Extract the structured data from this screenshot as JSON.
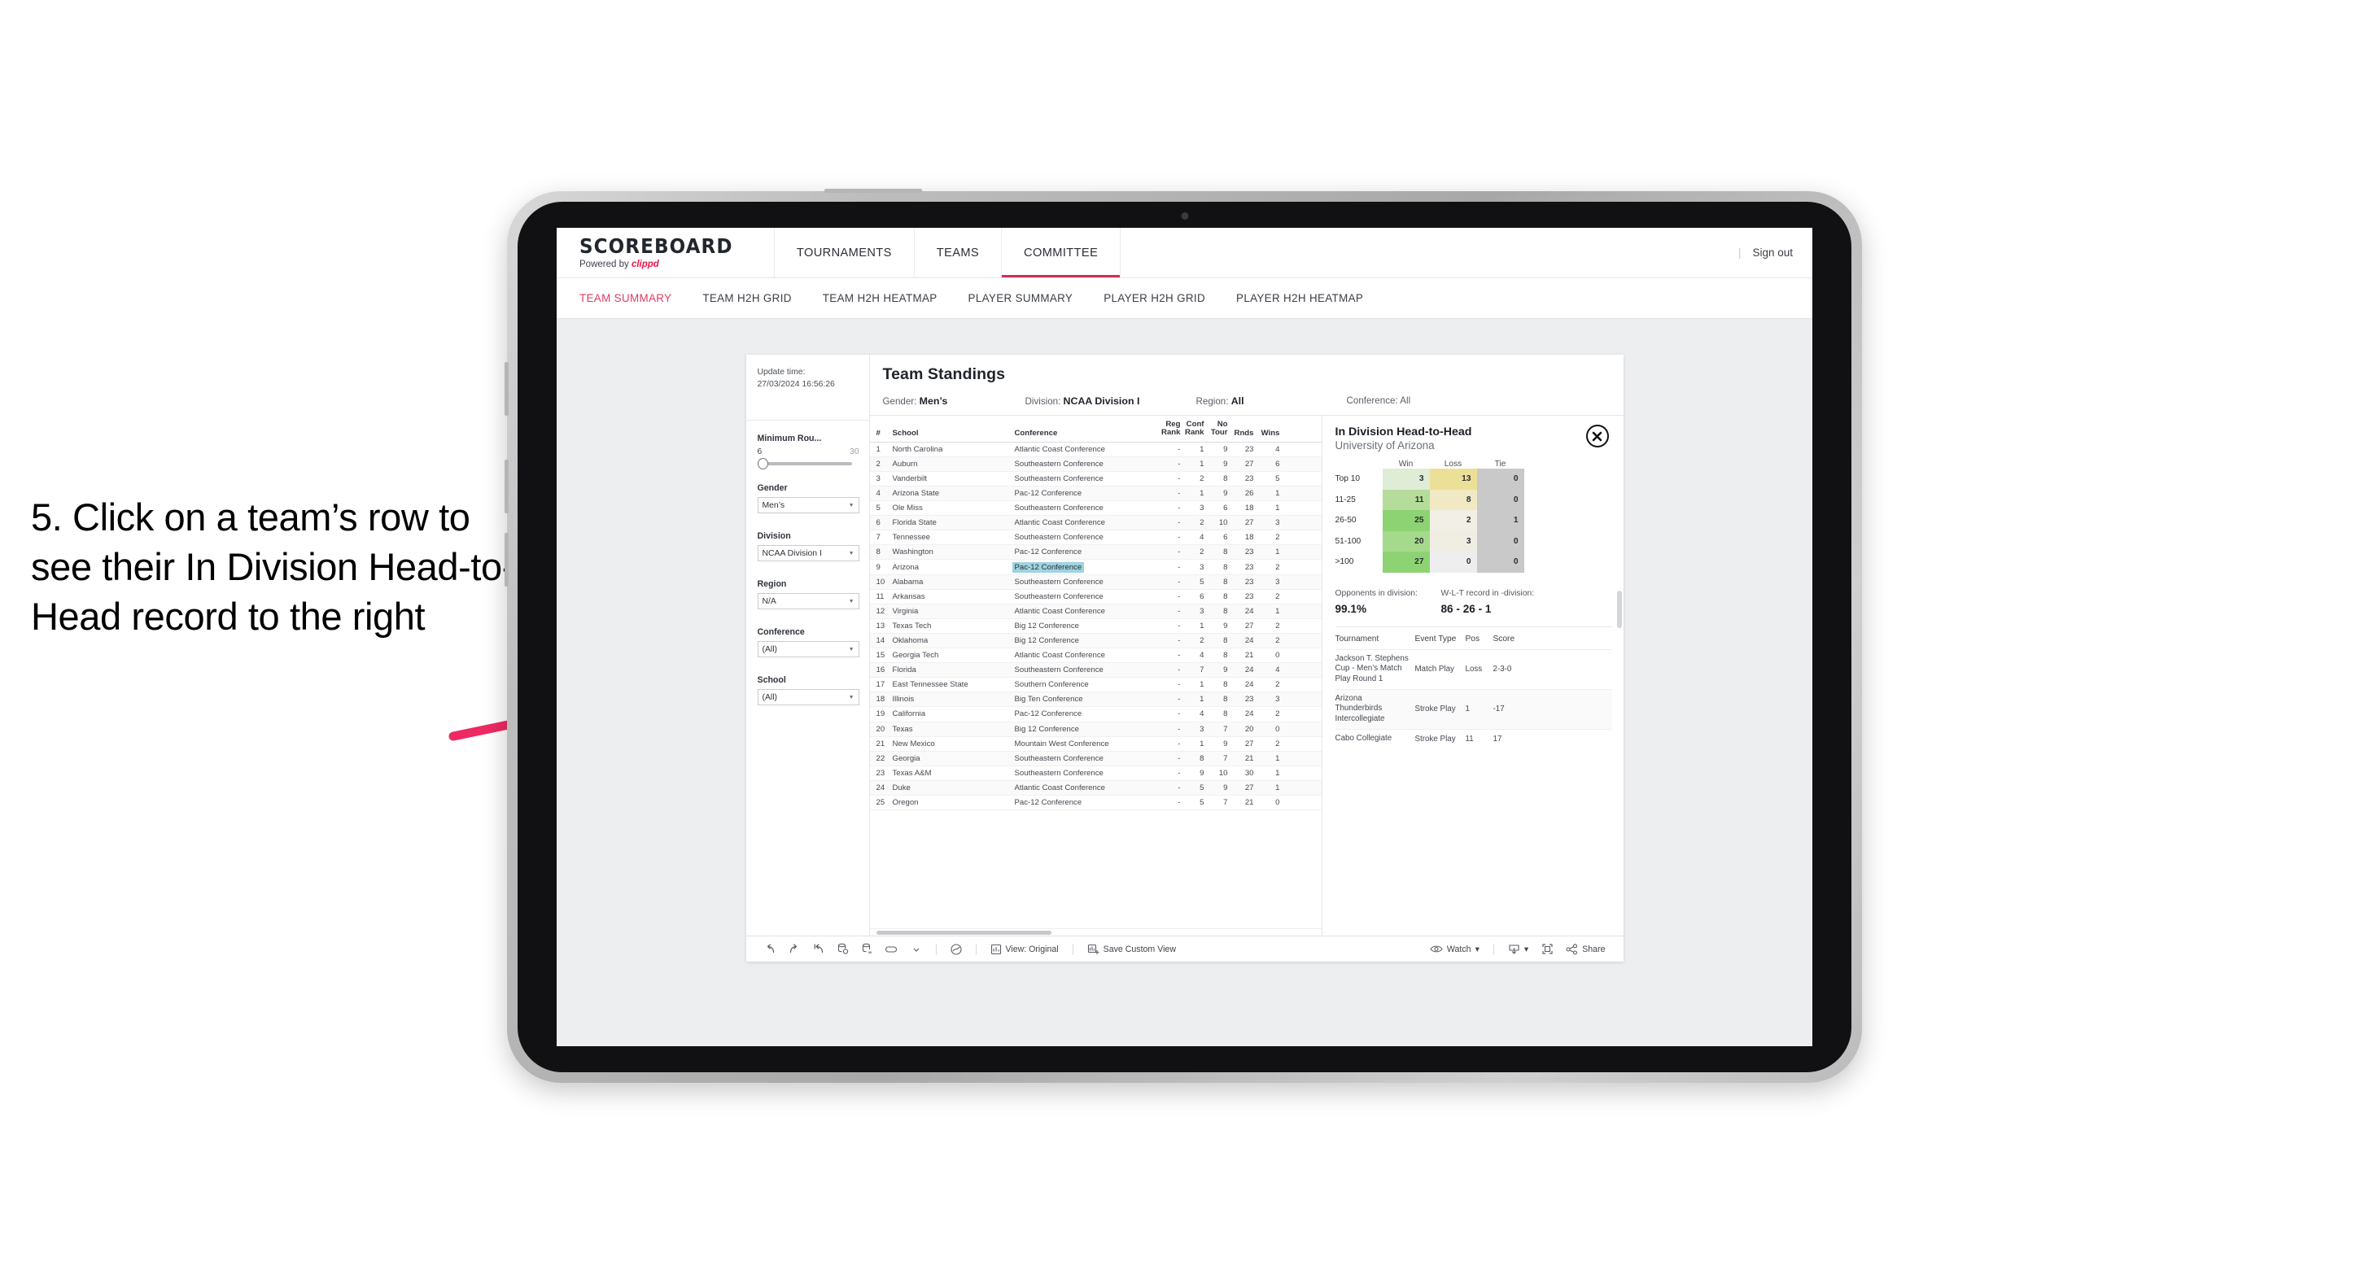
{
  "annotation": {
    "text": "5. Click on a team’s row to see their In Division Head-to-Head record to the right",
    "arrow_color": "#ed2a63"
  },
  "header": {
    "brand_title": "SCOREBOARD",
    "brand_sub_prefix": "Powered by ",
    "brand_sub_name": "clippd",
    "nav": [
      {
        "label": "TOURNAMENTS",
        "active": false
      },
      {
        "label": "TEAMS",
        "active": false
      },
      {
        "label": "COMMITTEE",
        "active": true
      }
    ],
    "divider": "|",
    "sign_out": "Sign out"
  },
  "subnav": {
    "items": [
      {
        "label": "TEAM SUMMARY",
        "active": true
      },
      {
        "label": "TEAM H2H GRID",
        "active": false
      },
      {
        "label": "TEAM H2H HEATMAP",
        "active": false
      },
      {
        "label": "PLAYER SUMMARY",
        "active": false
      },
      {
        "label": "PLAYER H2H GRID",
        "active": false
      },
      {
        "label": "PLAYER H2H HEATMAP",
        "active": false
      }
    ]
  },
  "filters": {
    "update_time_label": "Update time:",
    "update_time_value": "27/03/2024 16:56:26",
    "min_rounds": {
      "title": "Minimum Rou...",
      "min": "6",
      "max": "30"
    },
    "groups": [
      {
        "title": "Gender",
        "value": "Men’s"
      },
      {
        "title": "Division",
        "value": "NCAA Division I"
      },
      {
        "title": "Region",
        "value": "N/A"
      },
      {
        "title": "Conference",
        "value": "(All)"
      },
      {
        "title": "School",
        "value": "(All)"
      }
    ]
  },
  "standings": {
    "title": "Team Standings",
    "summary": [
      {
        "label": "Gender:",
        "value": "Men’s"
      },
      {
        "label": "Division:",
        "value": "NCAA Division I"
      },
      {
        "label": "Region:",
        "value": "All"
      },
      {
        "label": "Conference:",
        "value": "All"
      }
    ],
    "columns": {
      "num": "#",
      "school": "School",
      "conference": "Conference",
      "reg_rank_l1": "Reg",
      "reg_rank_l2": "Rank",
      "conf_rank_l1": "Conf",
      "conf_rank_l2": "Rank",
      "no_tour_l1": "No",
      "no_tour_l2": "Tour",
      "rnds": "Rnds",
      "wins": "Wins"
    },
    "rows": [
      {
        "num": "1",
        "school": "North Carolina",
        "conf": "Atlantic Coast Conference",
        "reg": "-",
        "confrank": "1",
        "notour": "9",
        "rnds": "23",
        "wins": "4",
        "selected": false
      },
      {
        "num": "2",
        "school": "Auburn",
        "conf": "Southeastern Conference",
        "reg": "-",
        "confrank": "1",
        "notour": "9",
        "rnds": "27",
        "wins": "6",
        "selected": false
      },
      {
        "num": "3",
        "school": "Vanderbilt",
        "conf": "Southeastern Conference",
        "reg": "-",
        "confrank": "2",
        "notour": "8",
        "rnds": "23",
        "wins": "5",
        "selected": false
      },
      {
        "num": "4",
        "school": "Arizona State",
        "conf": "Pac-12 Conference",
        "reg": "-",
        "confrank": "1",
        "notour": "9",
        "rnds": "26",
        "wins": "1",
        "selected": false
      },
      {
        "num": "5",
        "school": "Ole Miss",
        "conf": "Southeastern Conference",
        "reg": "-",
        "confrank": "3",
        "notour": "6",
        "rnds": "18",
        "wins": "1",
        "selected": false
      },
      {
        "num": "6",
        "school": "Florida State",
        "conf": "Atlantic Coast Conference",
        "reg": "-",
        "confrank": "2",
        "notour": "10",
        "rnds": "27",
        "wins": "3",
        "selected": false
      },
      {
        "num": "7",
        "school": "Tennessee",
        "conf": "Southeastern Conference",
        "reg": "-",
        "confrank": "4",
        "notour": "6",
        "rnds": "18",
        "wins": "2",
        "selected": false
      },
      {
        "num": "8",
        "school": "Washington",
        "conf": "Pac-12 Conference",
        "reg": "-",
        "confrank": "2",
        "notour": "8",
        "rnds": "23",
        "wins": "1",
        "selected": false
      },
      {
        "num": "9",
        "school": "Arizona",
        "conf": "Pac-12 Conference",
        "reg": "-",
        "confrank": "3",
        "notour": "8",
        "rnds": "23",
        "wins": "2",
        "selected": true
      },
      {
        "num": "10",
        "school": "Alabama",
        "conf": "Southeastern Conference",
        "reg": "-",
        "confrank": "5",
        "notour": "8",
        "rnds": "23",
        "wins": "3",
        "selected": false
      },
      {
        "num": "11",
        "school": "Arkansas",
        "conf": "Southeastern Conference",
        "reg": "-",
        "confrank": "6",
        "notour": "8",
        "rnds": "23",
        "wins": "2",
        "selected": false
      },
      {
        "num": "12",
        "school": "Virginia",
        "conf": "Atlantic Coast Conference",
        "reg": "-",
        "confrank": "3",
        "notour": "8",
        "rnds": "24",
        "wins": "1",
        "selected": false
      },
      {
        "num": "13",
        "school": "Texas Tech",
        "conf": "Big 12 Conference",
        "reg": "-",
        "confrank": "1",
        "notour": "9",
        "rnds": "27",
        "wins": "2",
        "selected": false
      },
      {
        "num": "14",
        "school": "Oklahoma",
        "conf": "Big 12 Conference",
        "reg": "-",
        "confrank": "2",
        "notour": "8",
        "rnds": "24",
        "wins": "2",
        "selected": false
      },
      {
        "num": "15",
        "school": "Georgia Tech",
        "conf": "Atlantic Coast Conference",
        "reg": "-",
        "confrank": "4",
        "notour": "8",
        "rnds": "21",
        "wins": "0",
        "selected": false
      },
      {
        "num": "16",
        "school": "Florida",
        "conf": "Southeastern Conference",
        "reg": "-",
        "confrank": "7",
        "notour": "9",
        "rnds": "24",
        "wins": "4",
        "selected": false
      },
      {
        "num": "17",
        "school": "East Tennessee State",
        "conf": "Southern Conference",
        "reg": "-",
        "confrank": "1",
        "notour": "8",
        "rnds": "24",
        "wins": "2",
        "selected": false
      },
      {
        "num": "18",
        "school": "Illinois",
        "conf": "Big Ten Conference",
        "reg": "-",
        "confrank": "1",
        "notour": "8",
        "rnds": "23",
        "wins": "3",
        "selected": false
      },
      {
        "num": "19",
        "school": "California",
        "conf": "Pac-12 Conference",
        "reg": "-",
        "confrank": "4",
        "notour": "8",
        "rnds": "24",
        "wins": "2",
        "selected": false
      },
      {
        "num": "20",
        "school": "Texas",
        "conf": "Big 12 Conference",
        "reg": "-",
        "confrank": "3",
        "notour": "7",
        "rnds": "20",
        "wins": "0",
        "selected": false
      },
      {
        "num": "21",
        "school": "New Mexico",
        "conf": "Mountain West Conference",
        "reg": "-",
        "confrank": "1",
        "notour": "9",
        "rnds": "27",
        "wins": "2",
        "selected": false
      },
      {
        "num": "22",
        "school": "Georgia",
        "conf": "Southeastern Conference",
        "reg": "-",
        "confrank": "8",
        "notour": "7",
        "rnds": "21",
        "wins": "1",
        "selected": false
      },
      {
        "num": "23",
        "school": "Texas A&M",
        "conf": "Southeastern Conference",
        "reg": "-",
        "confrank": "9",
        "notour": "10",
        "rnds": "30",
        "wins": "1",
        "selected": false
      },
      {
        "num": "24",
        "school": "Duke",
        "conf": "Atlantic Coast Conference",
        "reg": "-",
        "confrank": "5",
        "notour": "9",
        "rnds": "27",
        "wins": "1",
        "selected": false
      },
      {
        "num": "25",
        "school": "Oregon",
        "conf": "Pac-12 Conference",
        "reg": "-",
        "confrank": "5",
        "notour": "7",
        "rnds": "21",
        "wins": "0",
        "selected": false
      }
    ]
  },
  "h2h": {
    "title": "In Division Head-to-Head",
    "subtitle": "University of Arizona",
    "close_icon": "close-icon",
    "columns": [
      "Win",
      "Loss",
      "Tie"
    ],
    "rows": [
      {
        "label": "Top 10",
        "win": "3",
        "loss": "13",
        "tie": "0",
        "win_color": "#dfecd6",
        "loss_color": "#ecdf97",
        "tie_color": "#c9c9c9"
      },
      {
        "label": "11-25",
        "win": "11",
        "loss": "8",
        "tie": "0",
        "win_color": "#b5dc9a",
        "loss_color": "#f0e9c4",
        "tie_color": "#c9c9c9"
      },
      {
        "label": "26-50",
        "win": "25",
        "loss": "2",
        "tie": "1",
        "win_color": "#8ed373",
        "loss_color": "#f2f0e6",
        "tie_color": "#c9c9c9"
      },
      {
        "label": "51-100",
        "win": "20",
        "loss": "3",
        "tie": "0",
        "win_color": "#a5d98c",
        "loss_color": "#f0eee3",
        "tie_color": "#c9c9c9"
      },
      {
        "label": ">100",
        "win": "27",
        "loss": "0",
        "tie": "0",
        "win_color": "#8ed373",
        "loss_color": "#eeeeee",
        "tie_color": "#c9c9c9"
      }
    ],
    "stats": [
      {
        "label": "Opponents in division:",
        "value": "99.1%"
      },
      {
        "label": "W-L-T record in -division:",
        "value": "86 - 26 - 1"
      }
    ],
    "tournament_columns": [
      "Tournament",
      "Event Type",
      "Pos",
      "Score"
    ],
    "tournaments": [
      {
        "name": "Jackson T. Stephens Cup - Men’s Match Play Round 1",
        "type": "Match Play",
        "pos": "Loss",
        "score": "2-3-0"
      },
      {
        "name": "Arizona Thunderbirds Intercollegiate",
        "type": "Stroke Play",
        "pos": "1",
        "score": "-17"
      },
      {
        "name": "Cabo Collegiate",
        "type": "Stroke Play",
        "pos": "11",
        "score": "17"
      }
    ]
  },
  "toolbar": {
    "icons": [
      "undo-icon",
      "redo-icon",
      "revert-icon",
      "refresh-data-icon",
      "pause-updates-icon",
      "pill-icon",
      "chevron-down-icon"
    ],
    "alerts_icon": "alerts-icon",
    "view_icon": "view-icon",
    "view_label": "View: Original",
    "save_icon": "save-view-icon",
    "save_label": "Save Custom View",
    "watch_icon": "eye-icon",
    "watch_label": "Watch",
    "watch_caret": "▾",
    "download_icon": "download-icon",
    "download_caret": "▾",
    "fullscreen_icon": "fullscreen-icon",
    "share_icon": "share-icon",
    "share_label": "Share"
  }
}
